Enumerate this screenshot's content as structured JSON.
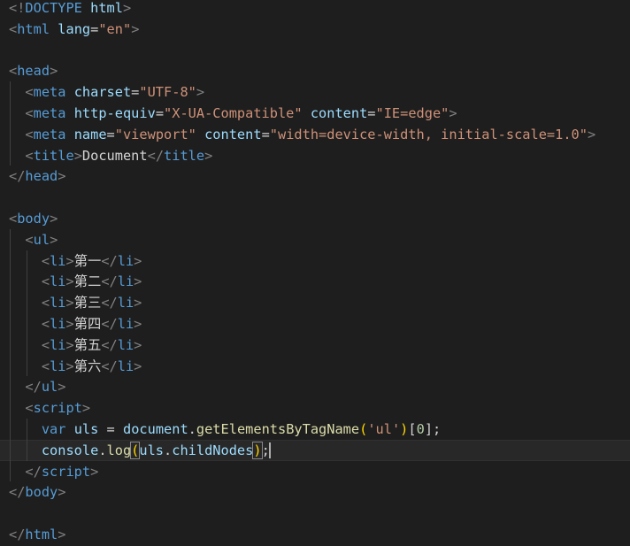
{
  "lines": [
    [
      {
        "c": "p",
        "t": "<!"
      },
      {
        "c": "t",
        "t": "DOCTYPE"
      },
      {
        "c": "d",
        "t": " "
      },
      {
        "c": "a",
        "t": "html"
      },
      {
        "c": "p",
        "t": ">"
      }
    ],
    [
      {
        "c": "p",
        "t": "<"
      },
      {
        "c": "t",
        "t": "html"
      },
      {
        "c": "d",
        "t": " "
      },
      {
        "c": "a",
        "t": "lang"
      },
      {
        "c": "d",
        "t": "="
      },
      {
        "c": "s",
        "t": "\"en\""
      },
      {
        "c": "p",
        "t": ">"
      }
    ],
    [],
    [
      {
        "c": "p",
        "t": "<"
      },
      {
        "c": "t",
        "t": "head"
      },
      {
        "c": "p",
        "t": ">"
      }
    ],
    [
      {
        "c": "d",
        "t": "  "
      },
      {
        "c": "p",
        "t": "<"
      },
      {
        "c": "t",
        "t": "meta"
      },
      {
        "c": "d",
        "t": " "
      },
      {
        "c": "a",
        "t": "charset"
      },
      {
        "c": "d",
        "t": "="
      },
      {
        "c": "s",
        "t": "\"UTF-8\""
      },
      {
        "c": "p",
        "t": ">"
      }
    ],
    [
      {
        "c": "d",
        "t": "  "
      },
      {
        "c": "p",
        "t": "<"
      },
      {
        "c": "t",
        "t": "meta"
      },
      {
        "c": "d",
        "t": " "
      },
      {
        "c": "a",
        "t": "http-equiv"
      },
      {
        "c": "d",
        "t": "="
      },
      {
        "c": "s",
        "t": "\"X-UA-Compatible\""
      },
      {
        "c": "d",
        "t": " "
      },
      {
        "c": "a",
        "t": "content"
      },
      {
        "c": "d",
        "t": "="
      },
      {
        "c": "s",
        "t": "\"IE=edge\""
      },
      {
        "c": "p",
        "t": ">"
      }
    ],
    [
      {
        "c": "d",
        "t": "  "
      },
      {
        "c": "p",
        "t": "<"
      },
      {
        "c": "t",
        "t": "meta"
      },
      {
        "c": "d",
        "t": " "
      },
      {
        "c": "a",
        "t": "name"
      },
      {
        "c": "d",
        "t": "="
      },
      {
        "c": "s",
        "t": "\"viewport\""
      },
      {
        "c": "d",
        "t": " "
      },
      {
        "c": "a",
        "t": "content"
      },
      {
        "c": "d",
        "t": "="
      },
      {
        "c": "s",
        "t": "\"width=device-width, initial-scale=1.0\""
      },
      {
        "c": "p",
        "t": ">"
      }
    ],
    [
      {
        "c": "d",
        "t": "  "
      },
      {
        "c": "p",
        "t": "<"
      },
      {
        "c": "t",
        "t": "title"
      },
      {
        "c": "p",
        "t": ">"
      },
      {
        "c": "d",
        "t": "Document"
      },
      {
        "c": "p",
        "t": "</"
      },
      {
        "c": "t",
        "t": "title"
      },
      {
        "c": "p",
        "t": ">"
      }
    ],
    [
      {
        "c": "p",
        "t": "</"
      },
      {
        "c": "t",
        "t": "head"
      },
      {
        "c": "p",
        "t": ">"
      }
    ],
    [],
    [
      {
        "c": "p",
        "t": "<"
      },
      {
        "c": "t",
        "t": "body"
      },
      {
        "c": "p",
        "t": ">"
      }
    ],
    [
      {
        "c": "d",
        "t": "  "
      },
      {
        "c": "p",
        "t": "<"
      },
      {
        "c": "t",
        "t": "ul"
      },
      {
        "c": "p",
        "t": ">"
      }
    ],
    [
      {
        "c": "d",
        "t": "    "
      },
      {
        "c": "p",
        "t": "<"
      },
      {
        "c": "t",
        "t": "li"
      },
      {
        "c": "p",
        "t": ">"
      },
      {
        "c": "d",
        "t": "第一"
      },
      {
        "c": "p",
        "t": "</"
      },
      {
        "c": "t",
        "t": "li"
      },
      {
        "c": "p",
        "t": ">"
      }
    ],
    [
      {
        "c": "d",
        "t": "    "
      },
      {
        "c": "p",
        "t": "<"
      },
      {
        "c": "t",
        "t": "li"
      },
      {
        "c": "p",
        "t": ">"
      },
      {
        "c": "d",
        "t": "第二"
      },
      {
        "c": "p",
        "t": "</"
      },
      {
        "c": "t",
        "t": "li"
      },
      {
        "c": "p",
        "t": ">"
      }
    ],
    [
      {
        "c": "d",
        "t": "    "
      },
      {
        "c": "p",
        "t": "<"
      },
      {
        "c": "t",
        "t": "li"
      },
      {
        "c": "p",
        "t": ">"
      },
      {
        "c": "d",
        "t": "第三"
      },
      {
        "c": "p",
        "t": "</"
      },
      {
        "c": "t",
        "t": "li"
      },
      {
        "c": "p",
        "t": ">"
      }
    ],
    [
      {
        "c": "d",
        "t": "    "
      },
      {
        "c": "p",
        "t": "<"
      },
      {
        "c": "t",
        "t": "li"
      },
      {
        "c": "p",
        "t": ">"
      },
      {
        "c": "d",
        "t": "第四"
      },
      {
        "c": "p",
        "t": "</"
      },
      {
        "c": "t",
        "t": "li"
      },
      {
        "c": "p",
        "t": ">"
      }
    ],
    [
      {
        "c": "d",
        "t": "    "
      },
      {
        "c": "p",
        "t": "<"
      },
      {
        "c": "t",
        "t": "li"
      },
      {
        "c": "p",
        "t": ">"
      },
      {
        "c": "d",
        "t": "第五"
      },
      {
        "c": "p",
        "t": "</"
      },
      {
        "c": "t",
        "t": "li"
      },
      {
        "c": "p",
        "t": ">"
      }
    ],
    [
      {
        "c": "d",
        "t": "    "
      },
      {
        "c": "p",
        "t": "<"
      },
      {
        "c": "t",
        "t": "li"
      },
      {
        "c": "p",
        "t": ">"
      },
      {
        "c": "d",
        "t": "第六"
      },
      {
        "c": "p",
        "t": "</"
      },
      {
        "c": "t",
        "t": "li"
      },
      {
        "c": "p",
        "t": ">"
      }
    ],
    [
      {
        "c": "d",
        "t": "  "
      },
      {
        "c": "p",
        "t": "</"
      },
      {
        "c": "t",
        "t": "ul"
      },
      {
        "c": "p",
        "t": ">"
      }
    ],
    [
      {
        "c": "d",
        "t": "  "
      },
      {
        "c": "p",
        "t": "<"
      },
      {
        "c": "t",
        "t": "script"
      },
      {
        "c": "p",
        "t": ">"
      }
    ],
    [
      {
        "c": "d",
        "t": "    "
      },
      {
        "c": "k",
        "t": "var"
      },
      {
        "c": "d",
        "t": " "
      },
      {
        "c": "v",
        "t": "uls"
      },
      {
        "c": "d",
        "t": " = "
      },
      {
        "c": "v",
        "t": "document"
      },
      {
        "c": "d",
        "t": "."
      },
      {
        "c": "f",
        "t": "getElementsByTagName"
      },
      {
        "c": "b",
        "t": "("
      },
      {
        "c": "s",
        "t": "'ul'"
      },
      {
        "c": "b",
        "t": ")"
      },
      {
        "c": "d",
        "t": "["
      },
      {
        "c": "n",
        "t": "0"
      },
      {
        "c": "d",
        "t": "];"
      }
    ],
    [
      {
        "c": "d",
        "t": "    "
      },
      {
        "c": "v",
        "t": "console"
      },
      {
        "c": "d",
        "t": "."
      },
      {
        "c": "f",
        "t": "log"
      },
      {
        "c": "b",
        "t": "(",
        "m": 1
      },
      {
        "c": "v",
        "t": "uls"
      },
      {
        "c": "d",
        "t": "."
      },
      {
        "c": "v",
        "t": "childNodes"
      },
      {
        "c": "b",
        "t": ")",
        "m": 1
      },
      {
        "c": "d",
        "t": ";",
        "cursor": 1
      }
    ],
    [
      {
        "c": "d",
        "t": "  "
      },
      {
        "c": "p",
        "t": "</"
      },
      {
        "c": "t",
        "t": "script"
      },
      {
        "c": "p",
        "t": ">"
      }
    ],
    [
      {
        "c": "p",
        "t": "</"
      },
      {
        "c": "t",
        "t": "body"
      },
      {
        "c": "p",
        "t": ">"
      }
    ],
    [],
    [
      {
        "c": "p",
        "t": "</"
      },
      {
        "c": "t",
        "t": "html"
      },
      {
        "c": "p",
        "t": ">"
      }
    ]
  ],
  "current_line": 21,
  "colors": {
    "background": "#1e1e1e",
    "punctuation": "#808080",
    "tag": "#569cd6",
    "attribute": "#9cdcfe",
    "string": "#ce9178",
    "function": "#dcdcaa",
    "number": "#b5cea8",
    "bracket": "#ffd700"
  }
}
